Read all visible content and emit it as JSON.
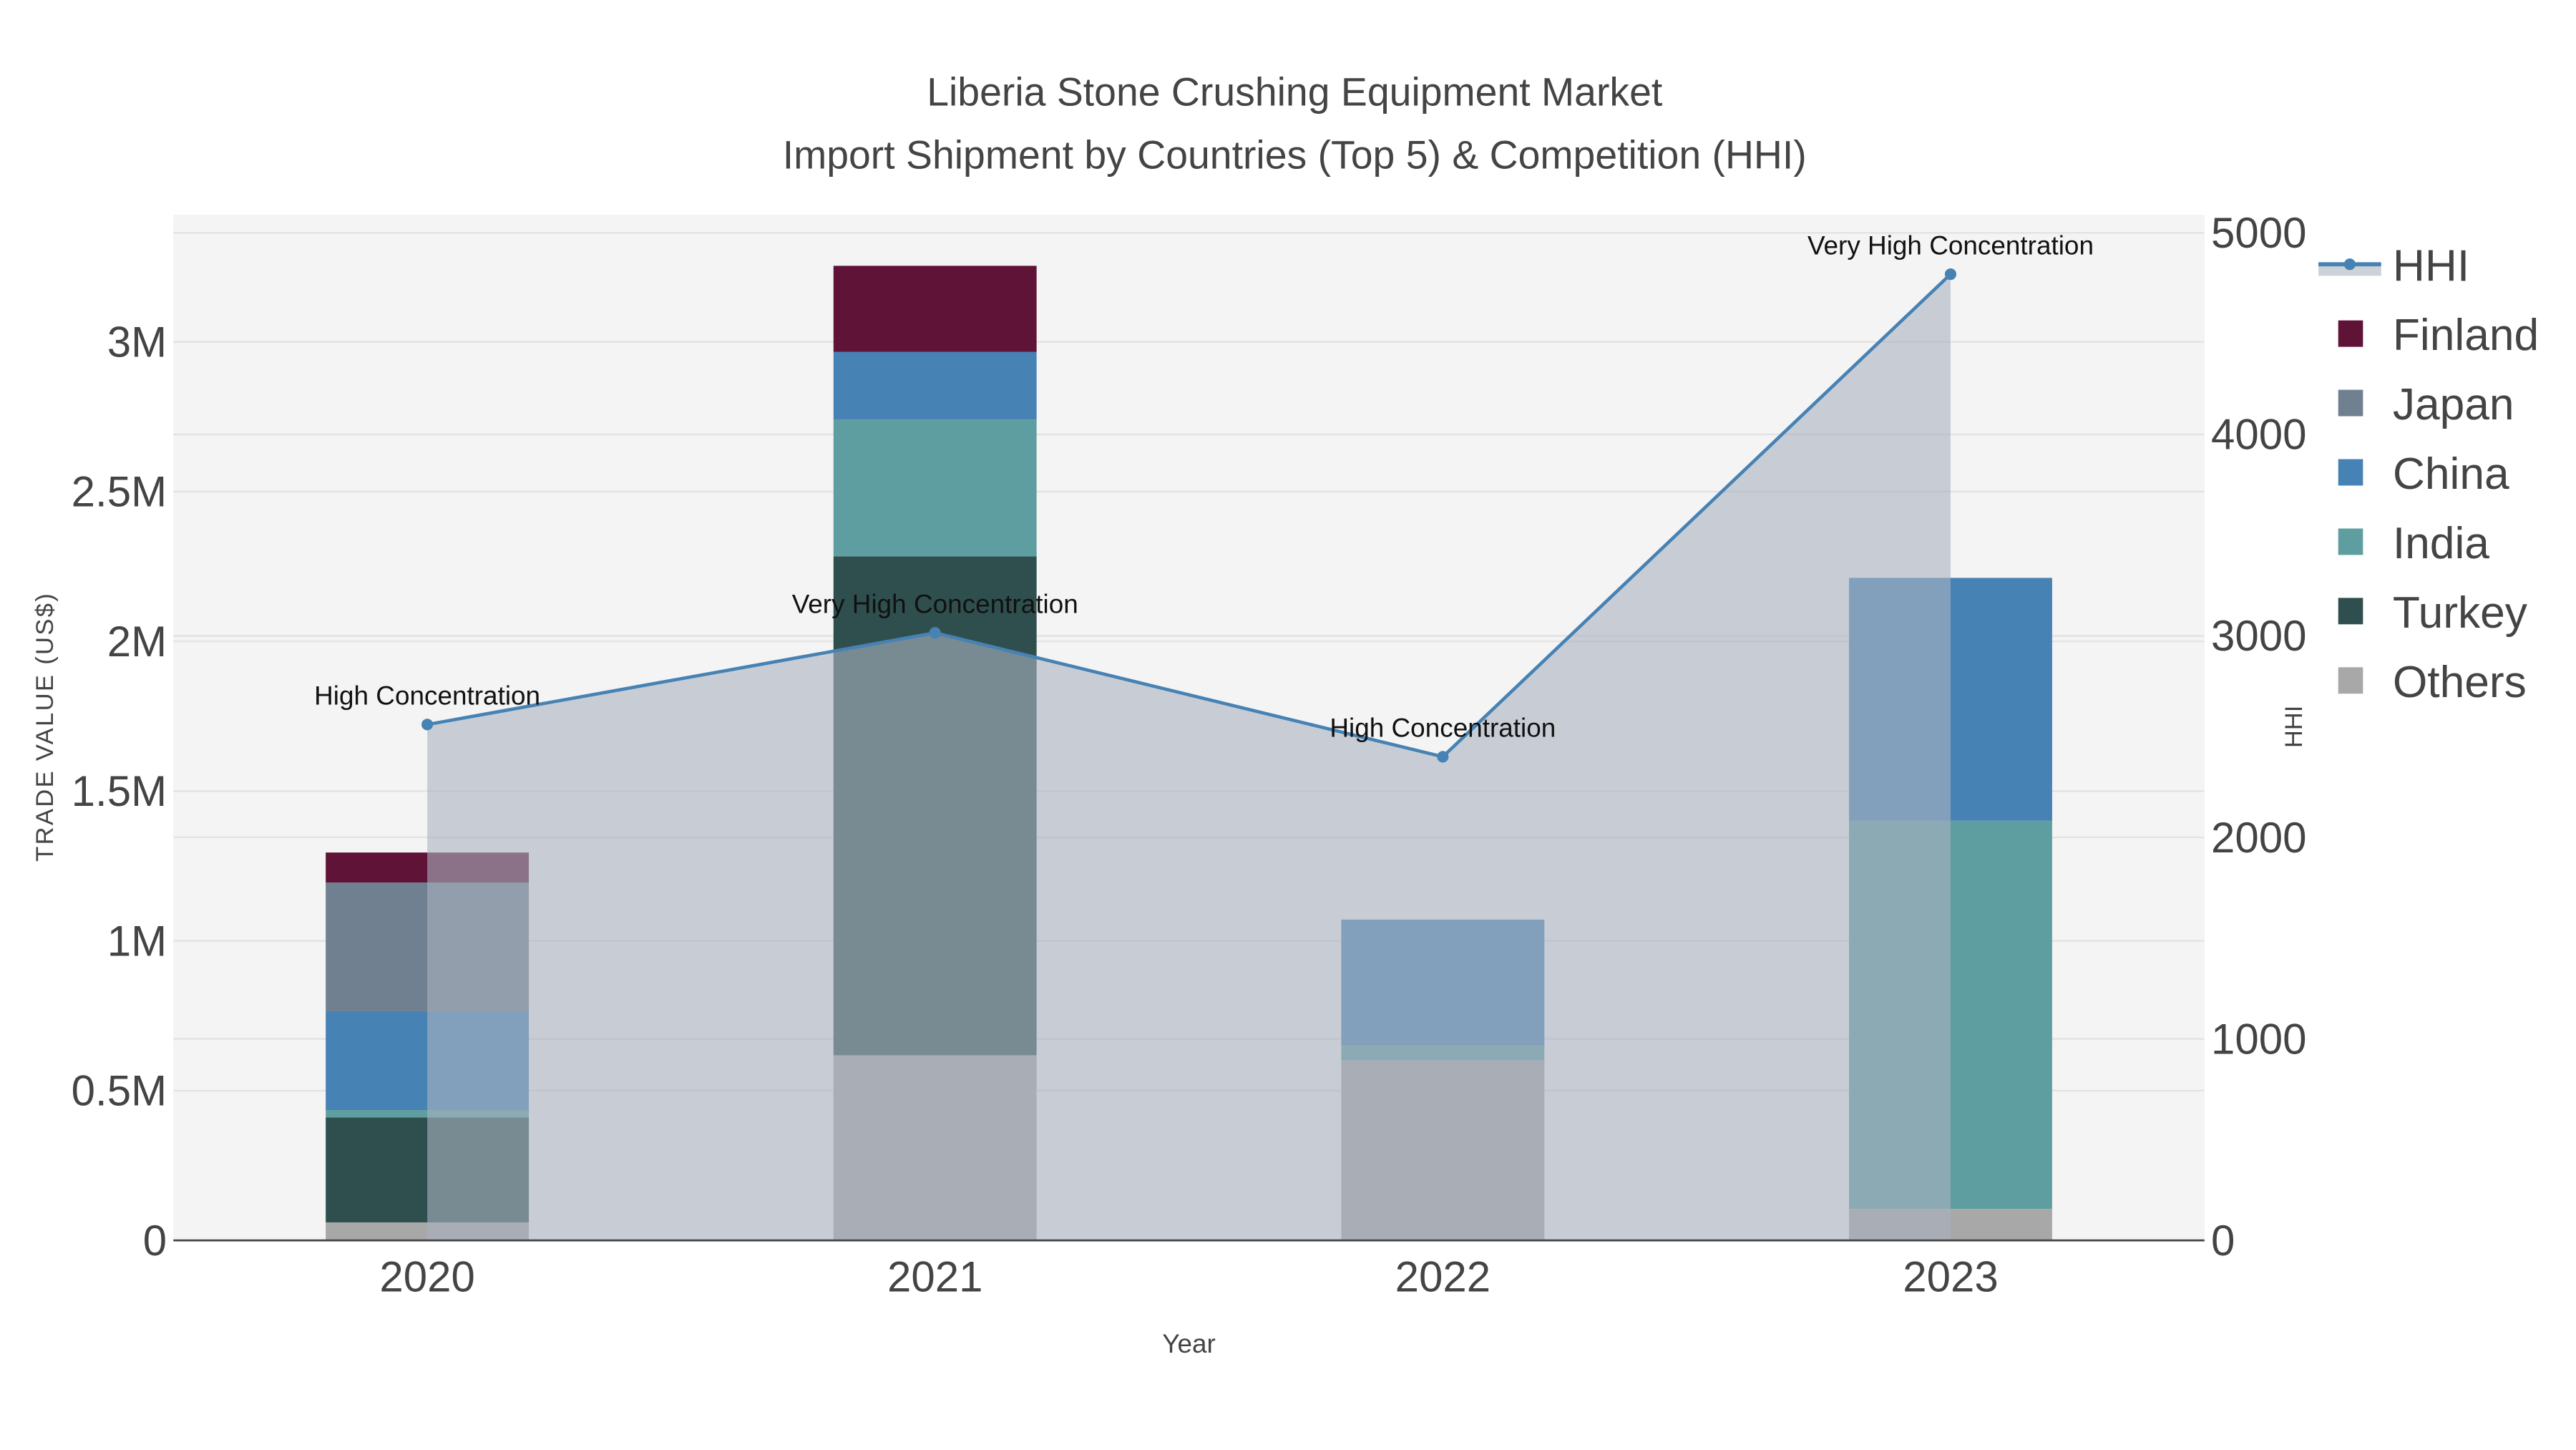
{
  "chart_data": {
    "type": "bar",
    "title": "Liberia Stone Crushing Equipment Market",
    "subtitle": "Import Shipment by Countries (Top 5) & Competition (HHI)",
    "xlabel": "Year",
    "ylabel": "TRADE VALUE (US$)",
    "y2label": "HHI",
    "categories": [
      "2020",
      "2021",
      "2022",
      "2023"
    ],
    "ylim": [
      0,
      3400000
    ],
    "y2lim": [
      0,
      5100
    ],
    "yticks": [
      0,
      500000,
      1000000,
      1500000,
      2000000,
      2500000,
      3000000
    ],
    "ytick_labels": [
      "0",
      "0.5M",
      "1M",
      "1.5M",
      "2M",
      "2.5M",
      "3M"
    ],
    "y2ticks": [
      0,
      1000,
      2000,
      3000,
      4000,
      5000
    ],
    "y2tick_labels": [
      "0",
      "1000",
      "2000",
      "3000",
      "4000",
      "5000"
    ],
    "stacked": true,
    "series": [
      {
        "name": "Others",
        "color": "#a8a8a8",
        "values": [
          60000,
          618000,
          601000,
          105000
        ]
      },
      {
        "name": "Turkey",
        "color": "#2f4f4f",
        "values": [
          350000,
          1666000,
          0,
          0
        ]
      },
      {
        "name": "India",
        "color": "#5f9ea0",
        "values": [
          25000,
          457000,
          50000,
          1296000
        ]
      },
      {
        "name": "China",
        "color": "#4682b4",
        "values": [
          330000,
          226000,
          420000,
          811000
        ]
      },
      {
        "name": "Japan",
        "color": "#708090",
        "values": [
          430000,
          0,
          0,
          0
        ]
      },
      {
        "name": "Finland",
        "color": "#5f1336",
        "values": [
          100000,
          287000,
          0,
          0
        ]
      }
    ],
    "line": {
      "name": "HHI",
      "color": "#4682b4",
      "fill": "rgba(170,178,192,0.6)",
      "values": [
        2560,
        3015,
        2400,
        4795
      ],
      "annotations": [
        "High Concentration",
        "Very High Concentration",
        "High Concentration",
        "Very High Concentration"
      ]
    },
    "legend": [
      "HHI",
      "Finland",
      "Japan",
      "China",
      "India",
      "Turkey",
      "Others"
    ],
    "legend_placement": "right",
    "grid": true
  }
}
